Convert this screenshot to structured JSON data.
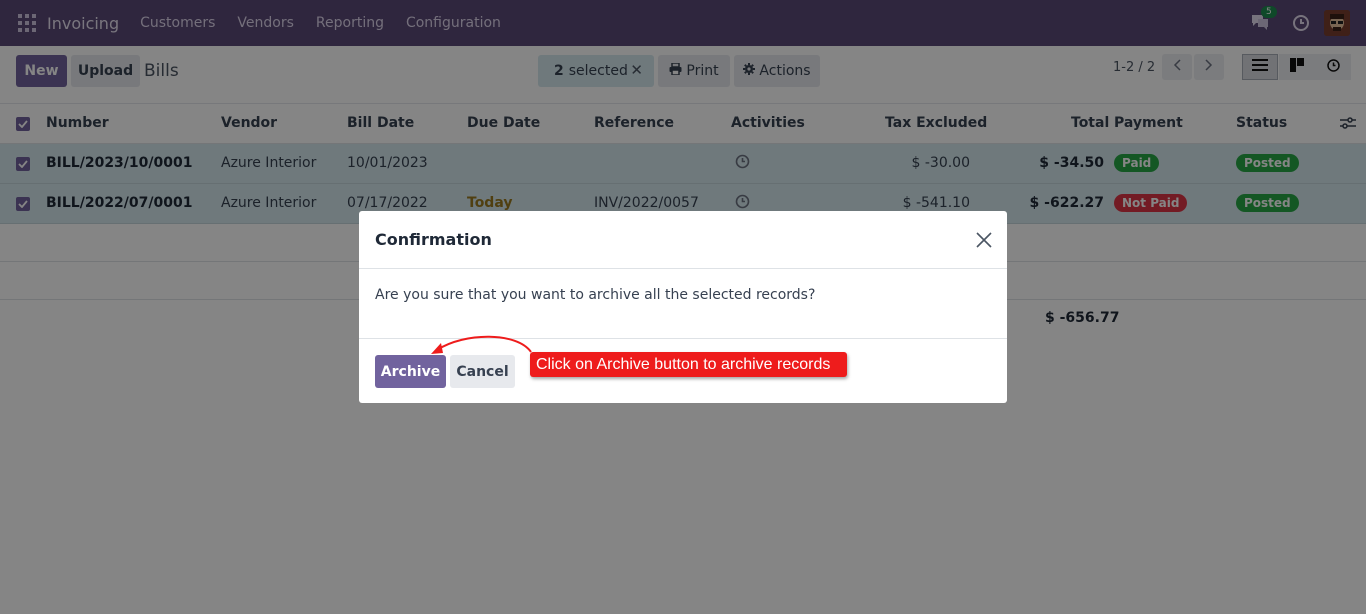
{
  "navbar": {
    "app_title": "Invoicing",
    "menu": [
      "Customers",
      "Vendors",
      "Reporting",
      "Configuration"
    ],
    "chat_count": "5",
    "accent": "#5b4a78"
  },
  "control": {
    "new_label": "New",
    "upload_label": "Upload",
    "breadcrumb": "Bills",
    "selected_count": "2",
    "selected_text": "selected",
    "print_label": "Print",
    "actions_label": "Actions",
    "pager": "1-2 / 2"
  },
  "table": {
    "columns": [
      "Number",
      "Vendor",
      "Bill Date",
      "Due Date",
      "Reference",
      "Activities",
      "Tax Excluded",
      "Total",
      "Payment",
      "Status"
    ],
    "rows": [
      {
        "number": "BILL/2023/10/0001",
        "vendor": "Azure Interior",
        "bill_date": "10/01/2023",
        "due_date": "",
        "reference": "",
        "tax_excluded": "$ -30.00",
        "total": "$ -34.50",
        "payment": "Paid",
        "payment_color": "#28a745",
        "status": "Posted"
      },
      {
        "number": "BILL/2022/07/0001",
        "vendor": "Azure Interior",
        "bill_date": "07/17/2022",
        "due_date": "Today",
        "reference": "INV/2022/0057",
        "tax_excluded": "$ -541.10",
        "total": "$ -622.27",
        "payment": "Not Paid",
        "payment_color": "#dc3545",
        "status": "Posted"
      }
    ],
    "grand_total": "$ -656.77"
  },
  "modal": {
    "title": "Confirmation",
    "body": "Are you sure that you want to archive all the selected records?",
    "archive_label": "Archive",
    "cancel_label": "Cancel"
  },
  "annotation": {
    "text": "Click on Archive button to archive records",
    "color": "#ee1c1c"
  }
}
